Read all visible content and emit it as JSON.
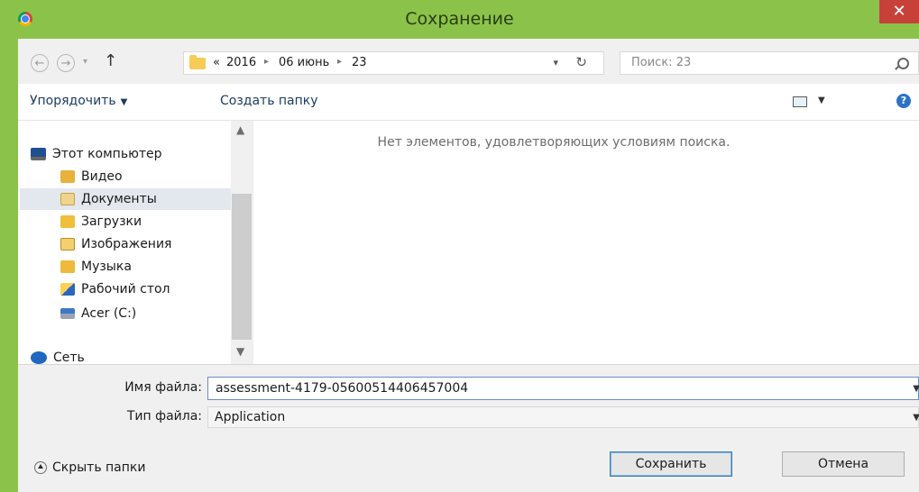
{
  "window": {
    "title": "Сохранение",
    "close_label": "✕"
  },
  "address": {
    "crumbs": [
      "«",
      "2016",
      "06 июнь",
      "23"
    ],
    "search_placeholder": "Поиск: 23"
  },
  "toolbar": {
    "organize_label": "Упорядочить",
    "new_folder_label": "Создать папку"
  },
  "nav": {
    "items": [
      {
        "label": "Этот компьютер",
        "icon": "computer-icon"
      },
      {
        "label": "Видео",
        "icon": "video-folder-icon"
      },
      {
        "label": "Документы",
        "icon": "documents-folder-icon",
        "selected": true
      },
      {
        "label": "Загрузки",
        "icon": "downloads-folder-icon"
      },
      {
        "label": "Изображения",
        "icon": "images-folder-icon"
      },
      {
        "label": "Музыка",
        "icon": "music-folder-icon"
      },
      {
        "label": "Рабочий стол",
        "icon": "desktop-folder-icon"
      },
      {
        "label": "Acer (C:)",
        "icon": "drive-icon"
      },
      {
        "label": "Сеть",
        "icon": "network-icon"
      }
    ]
  },
  "content": {
    "empty_message": "Нет элементов, удовлетворяющих условиям поиска."
  },
  "fields": {
    "filename_label": "Имя файла:",
    "filename_value": "assessment-4179-05600514406457004",
    "filetype_label": "Тип файла:",
    "filetype_value": "Application"
  },
  "footer": {
    "hide_folders_label": "Скрыть папки",
    "save_label": "Сохранить",
    "cancel_label": "Отмена"
  },
  "colors": {
    "frame": "#8bc34a",
    "close": "#c7413a",
    "selection": "#e3e8ee"
  }
}
